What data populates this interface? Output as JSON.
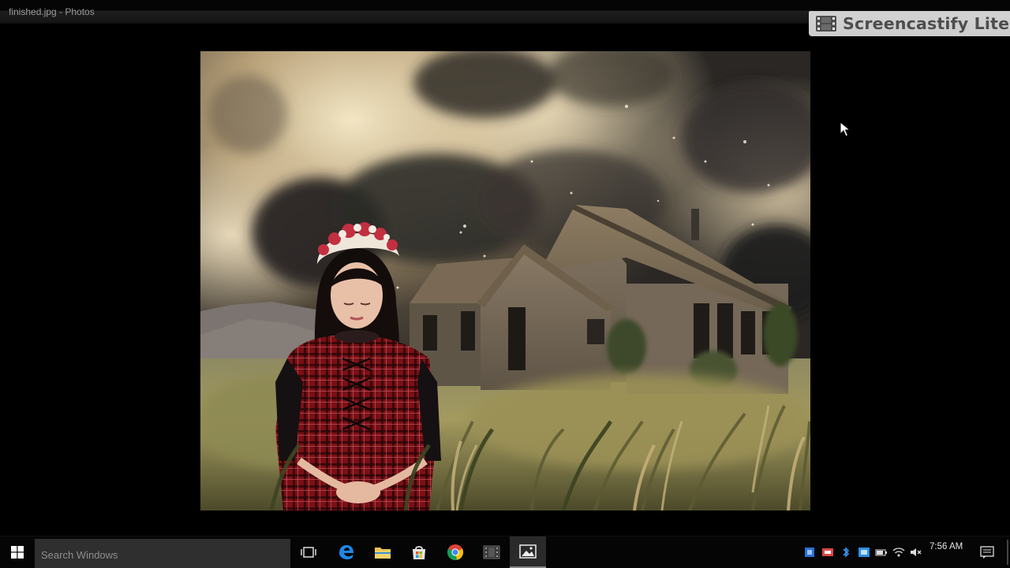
{
  "window": {
    "title": "finished.jpg - Photos"
  },
  "overlay": {
    "watermark_text": "Screencastify Lite",
    "watermark_icon": "film-strip-icon"
  },
  "photo": {
    "description_icon": "photo-composite",
    "subject": "woman in red plaid dress before abandoned wooden house"
  },
  "taskbar": {
    "search_placeholder": "Search Windows",
    "pinned": [
      {
        "name": "task-view-icon"
      },
      {
        "name": "edge-icon"
      },
      {
        "name": "file-explorer-icon"
      },
      {
        "name": "store-icon"
      },
      {
        "name": "chrome-icon"
      },
      {
        "name": "film-icon"
      },
      {
        "name": "photos-icon"
      }
    ],
    "clock": "7:56 AM"
  },
  "colors": {
    "taskbar_bg": "#050505",
    "search_bg": "#2f2f2f",
    "accent_blue": "#1e88e5"
  }
}
